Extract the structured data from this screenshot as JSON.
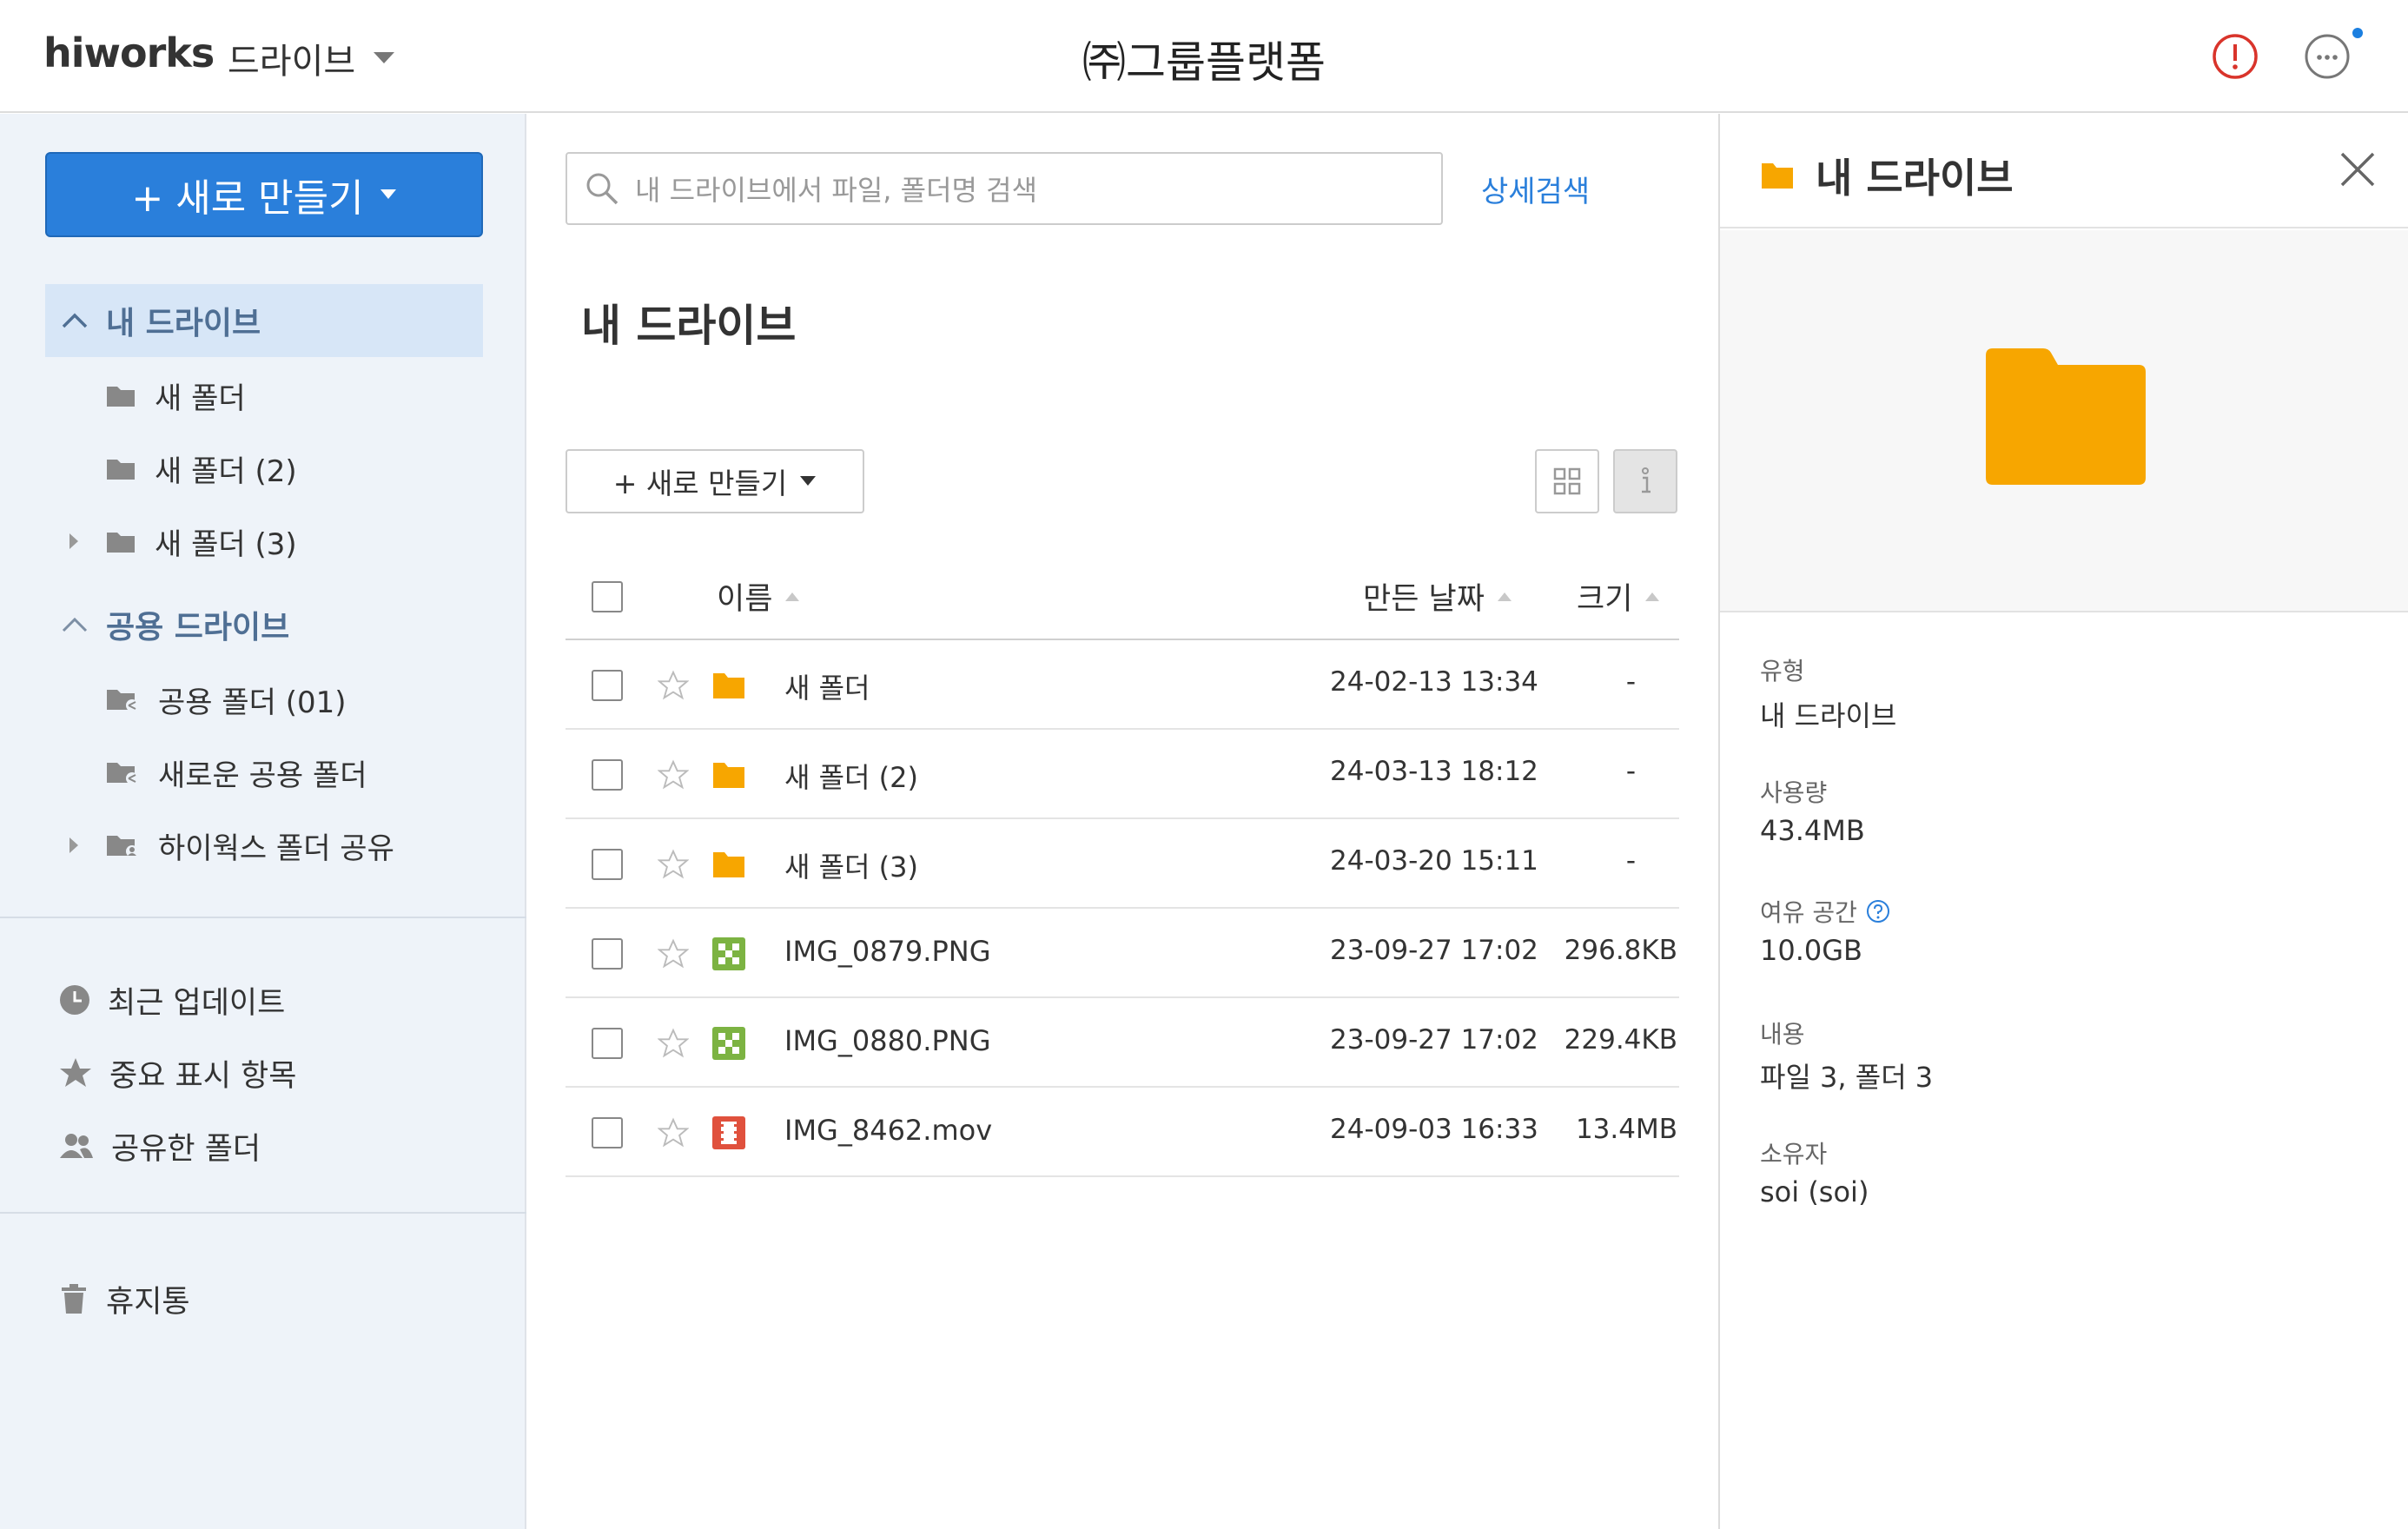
{
  "header": {
    "logo": "hiworks",
    "app_name": "드라이브",
    "company": "㈜그룹플랫폼",
    "icons": {
      "alert": "alert-icon",
      "more": "more-icon"
    },
    "accent_color": "#2a7fdb",
    "alert_color": "#d9342b"
  },
  "sidebar": {
    "new_button_label": "+ 새로 만들기",
    "my_drive": {
      "label": "내 드라이브",
      "folders": [
        "새 폴더",
        "새 폴더 (2)",
        "새 폴더 (3)"
      ]
    },
    "shared_drive": {
      "label": "공용 드라이브",
      "folders": [
        "공용 폴더 (01)",
        "새로운 공용 폴더",
        "하이웍스 폴더 공유"
      ]
    },
    "utility": {
      "recent": "최근 업데이트",
      "starred": "중요 표시 항목",
      "shared": "공유한 폴더"
    },
    "trash": "휴지통"
  },
  "main": {
    "search_placeholder": "내 드라이브에서 파일, 폴더명 검색",
    "advanced_search": "상세검색",
    "title": "내 드라이브",
    "new_button_label": "+ 새로 만들기",
    "columns": {
      "name": "이름",
      "created": "만든 날짜",
      "size": "크기"
    },
    "files": [
      {
        "name": "새 폴더",
        "date": "24-02-13 13:34",
        "size": "-",
        "type": "folder"
      },
      {
        "name": "새 폴더 (2)",
        "date": "24-03-13 18:12",
        "size": "-",
        "type": "folder"
      },
      {
        "name": "새 폴더 (3)",
        "date": "24-03-20 15:11",
        "size": "-",
        "type": "folder"
      },
      {
        "name": "IMG_0879.PNG",
        "date": "23-09-27 17:02",
        "size": "296.8KB",
        "type": "image"
      },
      {
        "name": "IMG_0880.PNG",
        "date": "23-09-27 17:02",
        "size": "229.4KB",
        "type": "image"
      },
      {
        "name": "IMG_8462.mov",
        "date": "24-09-03 16:33",
        "size": "13.4MB",
        "type": "video"
      }
    ]
  },
  "details": {
    "title": "내 드라이브",
    "type_label": "유형",
    "type_value": "내 드라이브",
    "usage_label": "사용량",
    "usage_value": "43.4MB",
    "free_label": "여유 공간",
    "free_value": "10.0GB",
    "contents_label": "내용",
    "contents_value": "파일 3, 폴더 3",
    "owner_label": "소유자",
    "owner_value": "soi (soi)"
  }
}
